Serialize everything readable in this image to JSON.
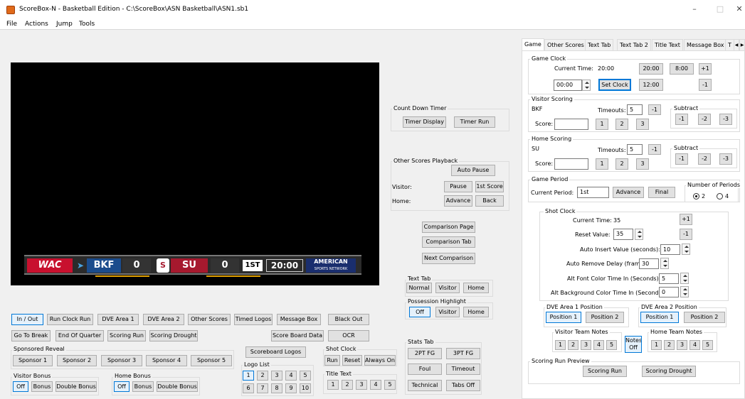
{
  "window": {
    "title": "ScoreBox-N - Basketball Edition - C:\\ScoreBox\\ASN Basketball\\ASN1.sb1",
    "minimize": "–",
    "maximize": "□",
    "close": "✕"
  },
  "menu": [
    "File",
    "Actions",
    "Jump",
    "Tools"
  ],
  "scoreboard": {
    "conference": "WAC",
    "visitor": "BKF",
    "visitor_score": "0",
    "home": "SU",
    "home_score": "0",
    "period": "1ST",
    "clock": "20:00",
    "network": "AMERICAN",
    "network_sub": "SPORTS NETWORK"
  },
  "countdown": {
    "title": "Count Down Timer",
    "display": "Timer Display",
    "run": "Timer Run"
  },
  "other_scores": {
    "title": "Other Scores Playback",
    "auto_pause": "Auto Pause",
    "visitor_label": "Visitor:",
    "home_label": "Home:",
    "pause": "Pause",
    "first_score": "1st Score",
    "advance": "Advance",
    "back": "Back"
  },
  "comparison": {
    "page": "Comparison Page",
    "tab": "Comparison Tab",
    "next": "Next Comparison"
  },
  "text_tab": {
    "title": "Text Tab",
    "normal": "Normal",
    "visitor": "Visitor",
    "home": "Home"
  },
  "possession": {
    "title": "Possession Highlight",
    "off": "Off",
    "visitor": "Visitor",
    "home": "Home"
  },
  "row1": [
    "In / Out",
    "Run Clock Run",
    "DVE Area 1",
    "DVE Area 2",
    "Other Scores",
    "Timed Logos",
    "Message Box",
    "Black Out"
  ],
  "row2": [
    "Go To Break",
    "End Of Quarter",
    "Scoring Run",
    "Scoring Drought"
  ],
  "score_board_data": "Score Board Data",
  "ocr": "OCR",
  "sponsored": {
    "title": "Sponsored Reveal",
    "items": [
      "Sponsor 1",
      "Sponsor 2",
      "Sponsor 3",
      "Sponsor 4",
      "Sponsor 5"
    ]
  },
  "scoreboard_logos": "Scoreboard Logos",
  "logo_list": {
    "title": "Logo List",
    "items": [
      "1",
      "2",
      "3",
      "4",
      "5",
      "6",
      "7",
      "8",
      "9",
      "10"
    ]
  },
  "shot_clock_left": {
    "title": "Shot Clock",
    "run": "Run",
    "reset": "Reset",
    "always_on": "Always On"
  },
  "title_text": {
    "title": "Title Text",
    "items": [
      "1",
      "2",
      "3",
      "4",
      "5"
    ]
  },
  "stats_tab": {
    "title": "Stats Tab",
    "items": [
      "2PT FG",
      "3PT FG",
      "Foul",
      "Timeout",
      "Technical",
      "Tabs Off"
    ]
  },
  "visitor_bonus": {
    "title": "Visitor Bonus",
    "off": "Off",
    "bonus": "Bonus",
    "double": "Double Bonus"
  },
  "home_bonus": {
    "title": "Home Bonus",
    "off": "Off",
    "bonus": "Bonus",
    "double": "Double Bonus"
  },
  "tabs": [
    "Game",
    "Other Scores",
    "Text Tab",
    "Text Tab 2",
    "Title Text",
    "Message Box",
    "T"
  ],
  "game_clock": {
    "title": "Game Clock",
    "current_label": "Current Time:",
    "current_value": "20:00",
    "b2000": "20:00",
    "b800": "8:00",
    "plus1": "+1",
    "input": "00:00",
    "set_clock": "Set Clock",
    "b1200": "12:00",
    "minus1": "-1"
  },
  "visitor_scoring": {
    "title": "Visitor Scoring",
    "team": "BKF",
    "timeouts_label": "Timeouts:",
    "timeouts": "5",
    "minus1": "-1",
    "score_label": "Score:",
    "score": "",
    "points": [
      "1",
      "2",
      "3"
    ],
    "subtract_title": "Subtract",
    "subtract": [
      "-1",
      "-2",
      "-3"
    ]
  },
  "home_scoring": {
    "title": "Home Scoring",
    "team": "SU",
    "timeouts_label": "Timeouts:",
    "timeouts": "5",
    "minus1": "-1",
    "score_label": "Score:",
    "score": "",
    "points": [
      "1",
      "2",
      "3"
    ],
    "subtract_title": "Subtract",
    "subtract": [
      "-1",
      "-2",
      "-3"
    ]
  },
  "game_period": {
    "title": "Game Period",
    "label": "Current Period:",
    "value": "1st",
    "advance": "Advance",
    "final": "Final",
    "num_title": "Number of Periods",
    "opt2": "2",
    "opt4": "4",
    "selected": "2"
  },
  "shot_clock": {
    "title": "Shot Clock",
    "current_label": "Current Time:",
    "current_value": "35",
    "plus1": "+1",
    "reset_label": "Reset Value:",
    "reset_value": "35",
    "minus1": "-1",
    "auto_insert_label": "Auto Insert Value (seconds):",
    "auto_insert": "10",
    "auto_remove_label": "Auto Remove Delay (frames):",
    "auto_remove": "30",
    "alt_font_label": "Alt Font Color Time In (Seconds):",
    "alt_font": "5",
    "alt_bg_label": "Alt Background Color Time In (Seconds):",
    "alt_bg": "0"
  },
  "dve1": {
    "title": "DVE Area 1 Position",
    "p1": "Position 1",
    "p2": "Position 2"
  },
  "dve2": {
    "title": "DVE Area 2 Position",
    "p1": "Position 1",
    "p2": "Position 2"
  },
  "visitor_notes": {
    "title": "Visitor Team Notes",
    "items": [
      "1",
      "2",
      "3",
      "4",
      "5"
    ]
  },
  "notes_off": {
    "line1": "Notes",
    "line2": "Off"
  },
  "home_notes": {
    "title": "Home Team Notes",
    "items": [
      "1",
      "2",
      "3",
      "4",
      "5"
    ]
  },
  "scoring_run_preview": {
    "title": "Scoring Run Preview",
    "run": "Scoring Run",
    "drought": "Scoring Drought"
  },
  "colors": {
    "accent": "#0078d7",
    "selected_bg": "#e5f1fb",
    "wac_red": "#c8102e",
    "su_red": "#a6192e",
    "bkf_blue": "#1b4c8c"
  }
}
